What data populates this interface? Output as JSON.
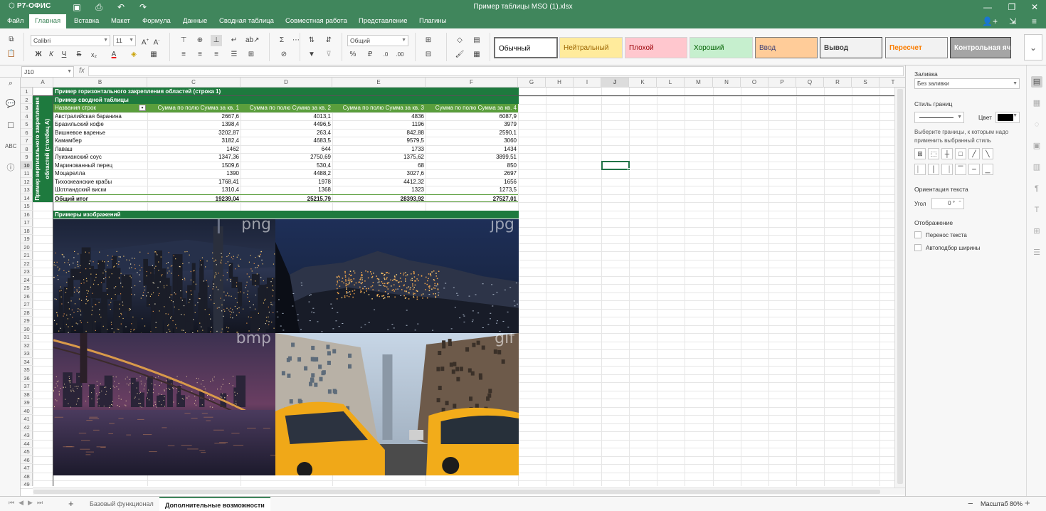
{
  "app": {
    "name": "Р7-ОФИС",
    "document_title": "Пример таблицы MSO (1).xlsx"
  },
  "menu": {
    "tabs": [
      "Файл",
      "Главная",
      "Вставка",
      "Макет",
      "Формула",
      "Данные",
      "Сводная таблица",
      "Совместная работа",
      "Представление",
      "Плагины"
    ],
    "active": "Главная"
  },
  "toolbar": {
    "font_name": "Calibri",
    "font_size": "11",
    "number_format": "Общий",
    "bold": "Ж",
    "italic": "К",
    "underline": "Ч",
    "strike": "Б",
    "subscript": "х₂",
    "font_color_label": "А",
    "percent": "%",
    "cell_styles": [
      {
        "label": "Обычный",
        "bg": "#ffffff",
        "fg": "#000000",
        "border": "#6f6f6f",
        "bold": false
      },
      {
        "label": "Нейтральный",
        "bg": "#ffeb9c",
        "fg": "#9c6500",
        "border": "#d4d4d4",
        "bold": false
      },
      {
        "label": "Плохой",
        "bg": "#ffc7ce",
        "fg": "#9c0006",
        "border": "#d4d4d4",
        "bold": false
      },
      {
        "label": "Хороший",
        "bg": "#c6efce",
        "fg": "#006100",
        "border": "#d4d4d4",
        "bold": false
      },
      {
        "label": "Ввод",
        "bg": "#ffcc99",
        "fg": "#3f3f76",
        "border": "#7f7f7f",
        "bold": false
      },
      {
        "label": "Вывод",
        "bg": "#f2f2f2",
        "fg": "#3f3f3f",
        "border": "#3f3f3f",
        "bold": true
      },
      {
        "label": "Пересчет",
        "bg": "#f2f2f2",
        "fg": "#fa7d00",
        "border": "#7f7f7f",
        "bold": true
      },
      {
        "label": "Контрольная яче",
        "bg": "#a5a5a5",
        "fg": "#ffffff",
        "border": "#3f3f3f",
        "bold": true
      }
    ]
  },
  "formula_bar": {
    "name_box": "J10",
    "fx_label": "fx",
    "formula": ""
  },
  "grid": {
    "columns": [
      "A",
      "B",
      "C",
      "D",
      "E",
      "F",
      "G",
      "H",
      "I",
      "J",
      "K",
      "L",
      "M",
      "N",
      "O",
      "P",
      "Q",
      "R",
      "S",
      "T"
    ],
    "rows": [
      "1",
      "2",
      "3",
      "4",
      "5",
      "6",
      "7",
      "8",
      "9",
      "10",
      "11",
      "12",
      "13",
      "14",
      "15",
      "16",
      "17",
      "18",
      "19",
      "20",
      "21",
      "22",
      "23",
      "24",
      "25",
      "26",
      "27",
      "28",
      "29",
      "30",
      "31",
      "32",
      "33",
      "34",
      "35",
      "36",
      "37",
      "38",
      "39",
      "40",
      "41",
      "42",
      "43",
      "44",
      "45",
      "46",
      "47",
      "48",
      "49"
    ],
    "selected_cell": "J10",
    "header_green": "#1e7a3e",
    "pivot_header_green": "#5a9e3c",
    "banner_row1": "Пример горизонтального закрепления областей (строка 1)",
    "banner_row2": "Пример сводной таблицы",
    "vertical_label": "Пример вертикального закрепления областей (столбец А)",
    "pivot_headers": [
      "Названия строк",
      "Сумма по полю Сумма за кв. 1",
      "Сумма по полю Сумма за кв. 2",
      "Сумма по полю Сумма за кв. 3",
      "Сумма по полю Сумма за кв. 4"
    ],
    "pivot_rows": [
      [
        "Австралийская баранина",
        "2667,6",
        "4013,1",
        "4836",
        "6087,9"
      ],
      [
        "Бразильский кофе",
        "1398,4",
        "4496,5",
        "1196",
        "3979"
      ],
      [
        "Вишневое варенье",
        "3202,87",
        "263,4",
        "842,88",
        "2590,1"
      ],
      [
        "Камамбер",
        "3182,4",
        "4683,5",
        "9579,5",
        "3060"
      ],
      [
        "Лаваш",
        "1462",
        "644",
        "1733",
        "1434"
      ],
      [
        "Луизианский соус",
        "1347,36",
        "2750,69",
        "1375,62",
        "3899,51"
      ],
      [
        "Маринованный перец",
        "1509,6",
        "530,4",
        "68",
        "850"
      ],
      [
        "Моцарелла",
        "1390",
        "4488,2",
        "3027,6",
        "2697"
      ],
      [
        "Тихоокеанские крабы",
        "1768,41",
        "1978",
        "4412,32",
        "1656"
      ],
      [
        "Шотландский виски",
        "1310,4",
        "1368",
        "1323",
        "1273,5"
      ]
    ],
    "pivot_total": [
      "Общий итог",
      "19239,04",
      "25215,79",
      "28393,92",
      "27527,01"
    ],
    "images_banner": "Примеры изображений",
    "image_labels": [
      "png",
      "jpg",
      "bmp",
      "gif"
    ]
  },
  "right_panel": {
    "fill_label": "Заливка",
    "fill_value": "Без заливки",
    "border_style_label": "Стиль границ",
    "color_label": "Цвет",
    "border_color": "#000000",
    "border_hint": "Выберите границы, к которым надо применить выбранный стиль",
    "orientation_label": "Ориентация текста",
    "angle_label": "Угол",
    "angle_value": "0 °",
    "display_label": "Отображение",
    "wrap_text": "Перенос текста",
    "autofit": "Автоподбор ширины"
  },
  "status": {
    "sheets": [
      "Базовый функционал",
      "Дополнительные возможности"
    ],
    "active_sheet": "Дополнительные возможности",
    "zoom_label": "Масштаб 80%"
  }
}
